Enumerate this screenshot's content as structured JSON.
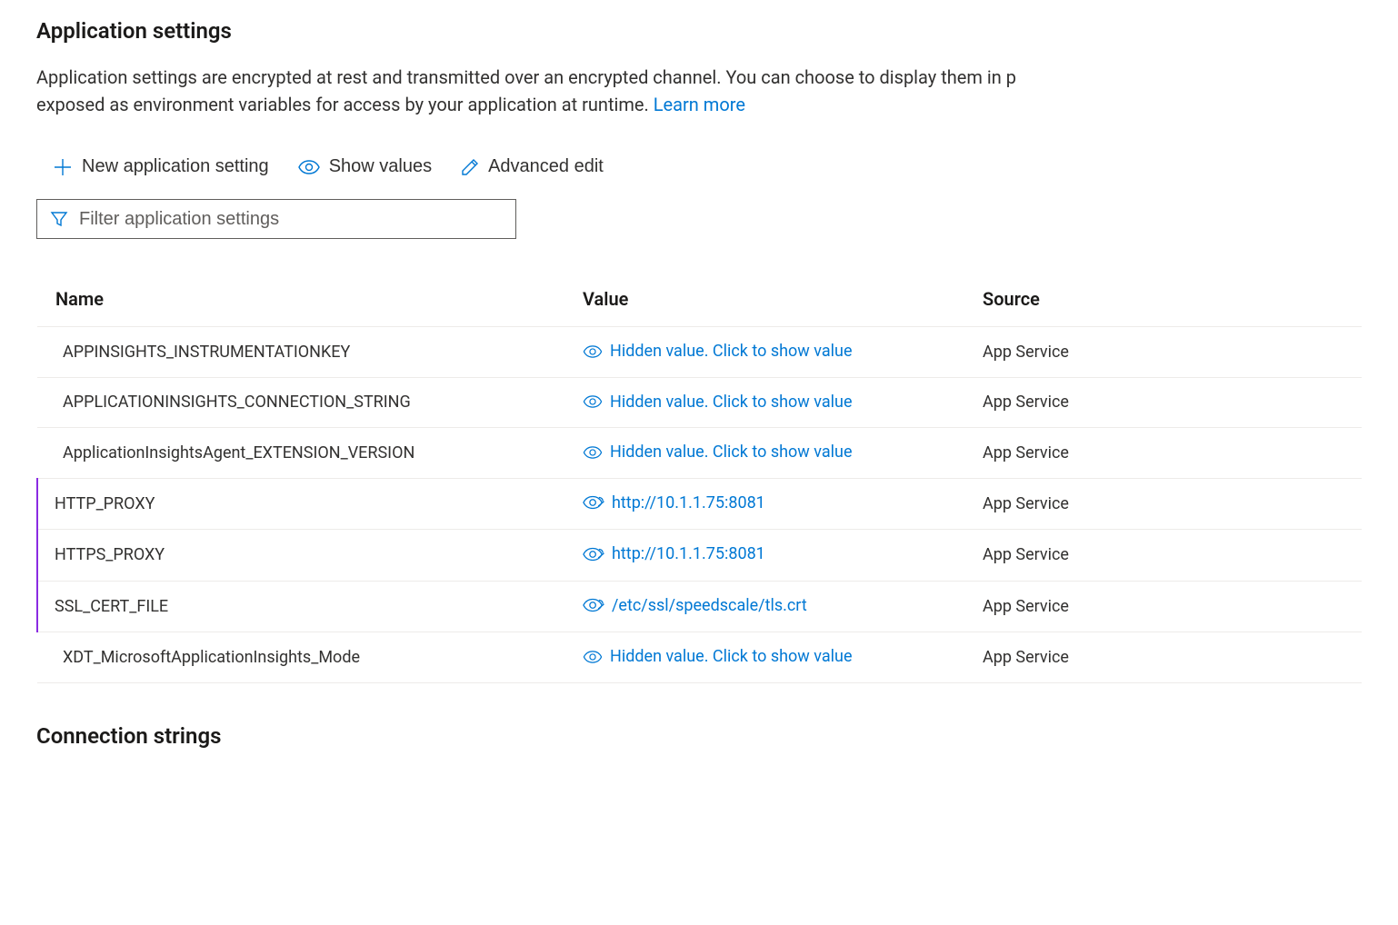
{
  "header": {
    "title": "Application settings",
    "description_pre": "Application settings are encrypted at rest and transmitted over an encrypted channel. You can choose to display them in p",
    "description_post": "exposed as environment variables for access by your application at runtime. ",
    "learn_more": "Learn more"
  },
  "toolbar": {
    "new_setting": "New application setting",
    "show_values": "Show values",
    "advanced_edit": "Advanced edit"
  },
  "filter": {
    "placeholder": "Filter application settings"
  },
  "table": {
    "columns": {
      "name": "Name",
      "value": "Value",
      "source": "Source"
    },
    "hidden_text": "Hidden value. Click to show value",
    "rows": [
      {
        "name": "APPINSIGHTS_INSTRUMENTATIONKEY",
        "value": "",
        "hidden": true,
        "source": "App Service",
        "modified": false
      },
      {
        "name": "APPLICATIONINSIGHTS_CONNECTION_STRING",
        "value": "",
        "hidden": true,
        "source": "App Service",
        "modified": false
      },
      {
        "name": "ApplicationInsightsAgent_EXTENSION_VERSION",
        "value": "",
        "hidden": true,
        "source": "App Service",
        "modified": false
      },
      {
        "name": "HTTP_PROXY",
        "value": "http://10.1.1.75:8081",
        "hidden": false,
        "source": "App Service",
        "modified": true
      },
      {
        "name": "HTTPS_PROXY",
        "value": "http://10.1.1.75:8081",
        "hidden": false,
        "source": "App Service",
        "modified": true
      },
      {
        "name": "SSL_CERT_FILE",
        "value": "/etc/ssl/speedscale/tls.crt",
        "hidden": false,
        "source": "App Service",
        "modified": true
      },
      {
        "name": "XDT_MicrosoftApplicationInsights_Mode",
        "value": "",
        "hidden": true,
        "source": "App Service",
        "modified": false
      }
    ]
  },
  "connection_strings": {
    "title": "Connection strings"
  }
}
